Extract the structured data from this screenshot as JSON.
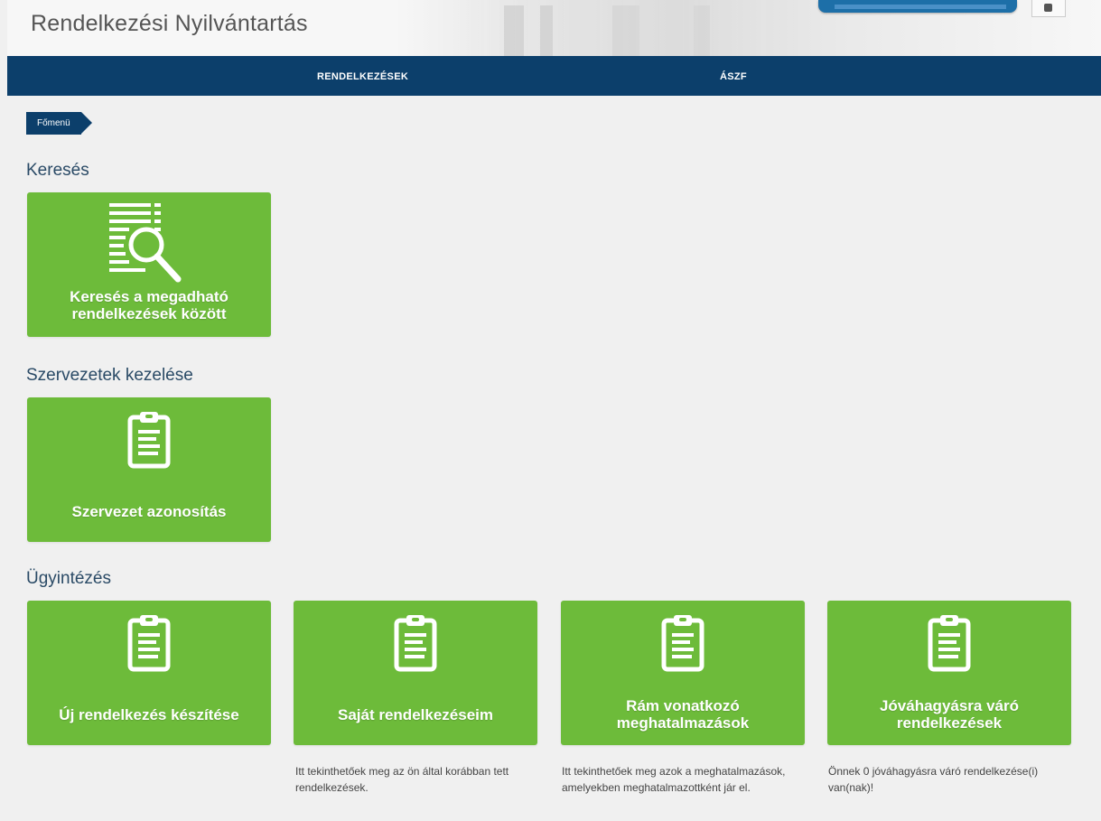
{
  "header": {
    "title": "Rendelkezési Nyilvántartás"
  },
  "nav": {
    "items": [
      {
        "label": "RENDELKEZÉSEK"
      },
      {
        "label": "ÁSZF"
      }
    ]
  },
  "breadcrumb": {
    "items": [
      {
        "label": "Főmenü"
      }
    ]
  },
  "sections": {
    "kereses": {
      "title": "Keresés",
      "tiles": [
        {
          "label": "Keresés a megadható rendelkezések között",
          "icon": "search-list-icon"
        }
      ]
    },
    "szervezetek": {
      "title": "Szervezetek kezelése",
      "tiles": [
        {
          "label": "Szervezet azonosítás",
          "icon": "clipboard-icon"
        }
      ]
    },
    "ugyintezes": {
      "title": "Ügyintézés",
      "tiles": [
        {
          "label": "Új rendelkezés készítése",
          "icon": "clipboard-icon",
          "description": ""
        },
        {
          "label": "Saját rendelkezéseim",
          "icon": "clipboard-icon",
          "description": "Itt tekinthetőek meg az ön által korábban tett rendelkezések."
        },
        {
          "label": "Rám vonatkozó meghatalmazások",
          "icon": "clipboard-icon",
          "description": "Itt tekinthetőek meg azok a meghatalmazások, amelyekben meghatalmazottként jár el."
        },
        {
          "label": "Jóváhagyásra váró rendelkezések",
          "icon": "clipboard-icon",
          "description": "Önnek 0 jóváhagyásra váró rendelkezése(i) van(nak)!"
        }
      ]
    }
  },
  "colors": {
    "nav_background": "#0c3f6b",
    "tile_green": "#6dbb3a",
    "section_title": "#2a4a66",
    "page_background": "#f0f0f0"
  }
}
